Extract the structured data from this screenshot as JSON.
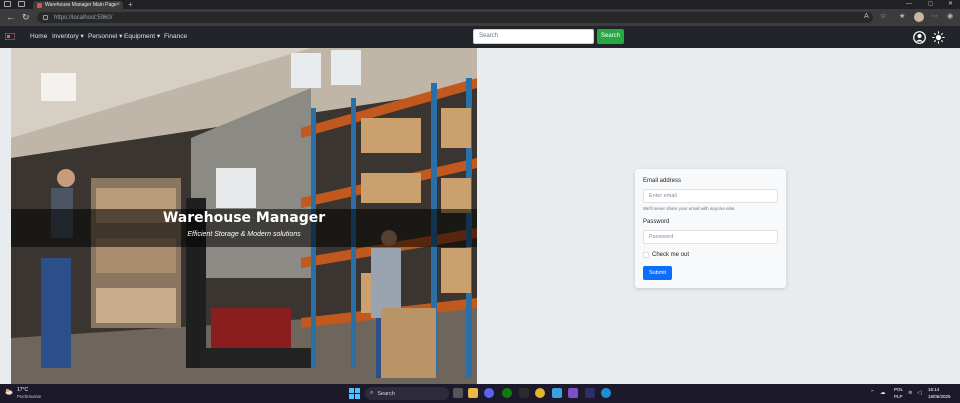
{
  "browser": {
    "tab_title": "Warehouse Manager Main Page",
    "tab_close": "×",
    "new_tab": "+",
    "url": "https://localhost:5960/",
    "win_minimize": "—",
    "win_maximize": "◻",
    "win_close": "✕"
  },
  "navbar": {
    "items": [
      {
        "label": "Home"
      },
      {
        "label": "Inventory ▾"
      },
      {
        "label": "Personnel ▾"
      },
      {
        "label": "Equipment ▾"
      },
      {
        "label": "Finance"
      }
    ],
    "search_placeholder": "Search",
    "search_button": "Search"
  },
  "hero": {
    "title": "Warehouse Manager",
    "subtitle": "Efficient Storage & Modern solutions"
  },
  "login": {
    "email_label": "Email address",
    "email_placeholder": "Enter email",
    "email_help": "We'll never share your email with anyone else.",
    "password_label": "Password",
    "password_placeholder": "Password",
    "remember_label": "Check me out",
    "submit_label": "Submit"
  },
  "taskbar": {
    "weather_temp": "17°C",
    "weather_desc": "Pochmurnie",
    "search_label": "Search",
    "lang_top": "POL",
    "lang_bottom": "PLP",
    "time": "16:14",
    "date": "18/05/2025"
  },
  "colors": {
    "navbar_bg": "#212529",
    "search_button": "#28a745",
    "submit_button": "#0d6efd",
    "page_bg": "#e9ecef"
  }
}
